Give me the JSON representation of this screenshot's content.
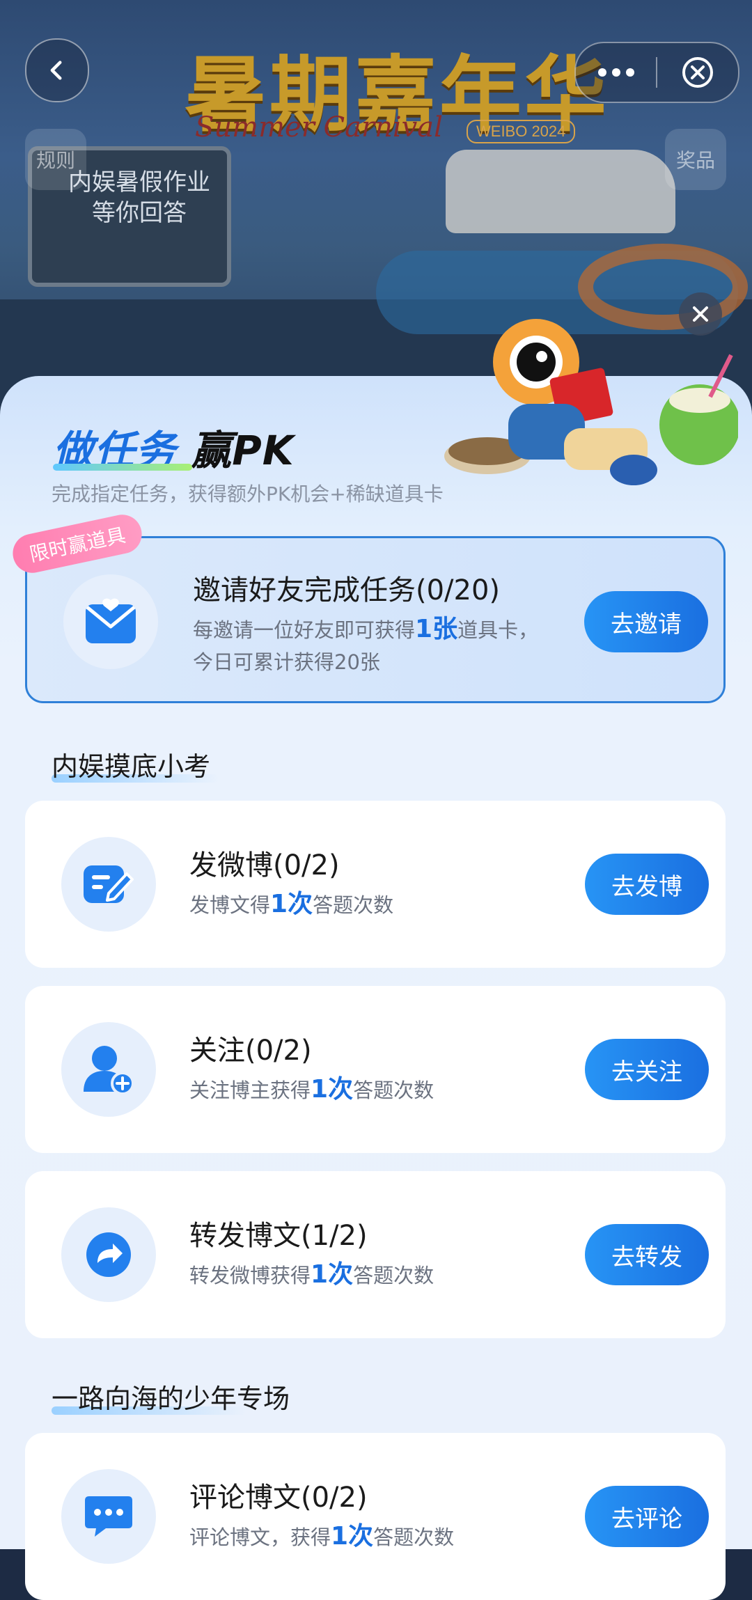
{
  "poster": {
    "title": "暑期嘉年华",
    "subtitle": "Summer Carnival",
    "year_badge": "WEIBO 2024",
    "board_text": "内娱暑假作业 等你回答",
    "rules_label": "规则",
    "prizes_label": "奖品"
  },
  "sheet": {
    "title_part1": "做任务",
    "title_part2": "赢PK",
    "subtitle": "完成指定任务，获得额外PK机会+稀缺道具卡"
  },
  "invite": {
    "ribbon": "限时赢道具",
    "title": "邀请好友完成任务(0/20)",
    "desc_pre": "每邀请一位好友即可获得",
    "desc_num": "1张",
    "desc_post": "道具卡，",
    "desc_line2": "今日可累计获得20张",
    "button": "去邀请"
  },
  "sections": [
    {
      "heading": "内娱摸底小考",
      "tasks": [
        {
          "title": "发微博(0/2)",
          "desc_pre": "发博文得",
          "desc_num": "1次",
          "desc_post": "答题次数",
          "button": "去发博",
          "icon": "edit-icon"
        },
        {
          "title": "关注(0/2)",
          "desc_pre": "关注博主获得",
          "desc_num": "1次",
          "desc_post": "答题次数",
          "button": "去关注",
          "icon": "add-user-icon"
        },
        {
          "title": "转发博文(1/2)",
          "desc_pre": "转发微博获得",
          "desc_num": "1次",
          "desc_post": "答题次数",
          "button": "去转发",
          "icon": "share-arrow-icon"
        }
      ]
    },
    {
      "heading": "一路向海的少年专场",
      "tasks": [
        {
          "title": "评论博文(0/2)",
          "desc_pre": "评论博文，获得",
          "desc_num": "1次",
          "desc_post": "答题次数",
          "button": "去评论",
          "icon": "comment-icon"
        }
      ]
    }
  ],
  "colors": {
    "accent": "#1a6fe0",
    "button_gradient_start": "#2794f5",
    "ribbon_pink": "#ff7db0",
    "card_border": "#2f80d8"
  }
}
